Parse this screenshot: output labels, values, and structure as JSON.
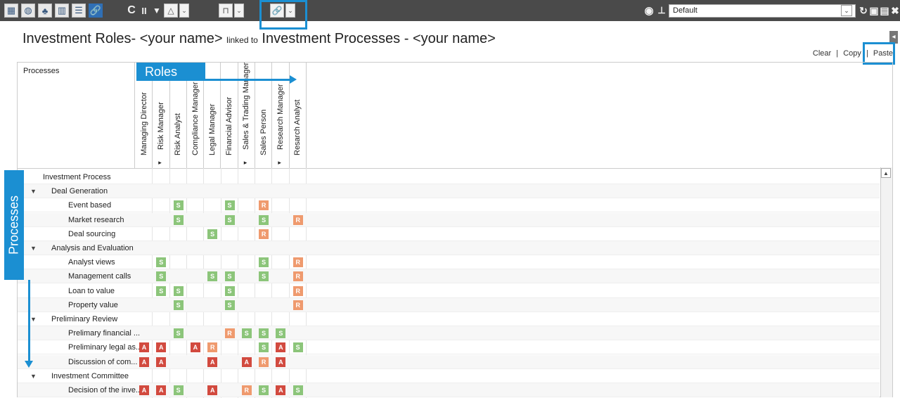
{
  "toolbar": {
    "left_icons": [
      {
        "name": "table-view-icon",
        "glyph": "▦"
      },
      {
        "name": "dashboard-icon",
        "glyph": "◍"
      },
      {
        "name": "hierarchy-icon",
        "glyph": "♣"
      },
      {
        "name": "bar-chart-icon",
        "glyph": "▥"
      },
      {
        "name": "list-icon",
        "glyph": "☰"
      },
      {
        "name": "link-icon",
        "glyph": "🔗"
      }
    ],
    "refresh_glyph": "C",
    "pause_glyph": "II",
    "filter_glyph": "▼",
    "triangle_glyph": "△",
    "bookmark_glyph": "⊓",
    "link_glyph": "🔗",
    "caret_glyph": "⌄",
    "camera_glyph": "◉",
    "pin_glyph": "⊥",
    "preset_value": "Default",
    "right_glyphs": [
      {
        "name": "refresh-icon",
        "glyph": "↻"
      },
      {
        "name": "save-as-icon",
        "glyph": "▣"
      },
      {
        "name": "save-icon",
        "glyph": "▤"
      },
      {
        "name": "close-icon",
        "glyph": "✖"
      }
    ]
  },
  "title": {
    "left": "Investment Roles- <your name>",
    "linked": "linked to",
    "right": "Investment Processes - <your name>"
  },
  "actions": {
    "clear": "Clear",
    "sep1": "|",
    "copy": "Copy",
    "sep2": "|",
    "paste": "Paste"
  },
  "grid": {
    "processes_header": "Processes",
    "roles": [
      {
        "label": "Managing Director",
        "arrow": false
      },
      {
        "label": "Risk Manager",
        "arrow": true
      },
      {
        "label": "Risk Analyst",
        "arrow": false
      },
      {
        "label": "Compliance Manager",
        "arrow": false
      },
      {
        "label": "Legal Manager",
        "arrow": false
      },
      {
        "label": "Financial Advisor",
        "arrow": false
      },
      {
        "label": "Sales & Trading Manager",
        "arrow": true
      },
      {
        "label": "Sales Person",
        "arrow": false
      },
      {
        "label": "Research Manager",
        "arrow": true
      },
      {
        "label": "Resarch Analyst",
        "arrow": false
      }
    ],
    "rows": [
      {
        "label": "Investment Process",
        "level": 0,
        "toggle": true,
        "cells": [
          "",
          "",
          "",
          "",
          "",
          "",
          "",
          "",
          "",
          ""
        ]
      },
      {
        "label": "Deal Generation",
        "level": 1,
        "toggle": true,
        "cells": [
          "",
          "",
          "",
          "",
          "",
          "",
          "",
          "",
          "",
          ""
        ]
      },
      {
        "label": "Event based",
        "level": 2,
        "toggle": false,
        "cells": [
          "",
          "",
          "S",
          "",
          "",
          "S",
          "",
          "R",
          "",
          ""
        ]
      },
      {
        "label": "Market research",
        "level": 2,
        "toggle": false,
        "cells": [
          "",
          "",
          "S",
          "",
          "",
          "S",
          "",
          "S",
          "",
          "R"
        ]
      },
      {
        "label": "Deal sourcing",
        "level": 2,
        "toggle": false,
        "cells": [
          "",
          "",
          "",
          "",
          "S",
          "",
          "",
          "R",
          "",
          ""
        ]
      },
      {
        "label": "Analysis and Evaluation",
        "level": 1,
        "toggle": true,
        "cells": [
          "",
          "",
          "",
          "",
          "",
          "",
          "",
          "",
          "",
          ""
        ]
      },
      {
        "label": "Analyst views",
        "level": 2,
        "toggle": false,
        "cells": [
          "",
          "S",
          "",
          "",
          "",
          "",
          "",
          "S",
          "",
          "R"
        ]
      },
      {
        "label": "Management calls",
        "level": 2,
        "toggle": false,
        "cells": [
          "",
          "S",
          "",
          "",
          "S",
          "S",
          "",
          "S",
          "",
          "R"
        ]
      },
      {
        "label": "Loan to value",
        "level": 2,
        "toggle": false,
        "cells": [
          "",
          "S",
          "S",
          "",
          "",
          "S",
          "",
          "",
          "",
          "R"
        ]
      },
      {
        "label": "Property value",
        "level": 2,
        "toggle": false,
        "cells": [
          "",
          "",
          "S",
          "",
          "",
          "S",
          "",
          "",
          "",
          "R"
        ]
      },
      {
        "label": "Preliminary Review",
        "level": 1,
        "toggle": true,
        "cells": [
          "",
          "",
          "",
          "",
          "",
          "",
          "",
          "",
          "",
          ""
        ]
      },
      {
        "label": "Prelimary financial ...",
        "level": 2,
        "toggle": false,
        "cells": [
          "",
          "",
          "S",
          "",
          "",
          "R",
          "S",
          "S",
          "S",
          ""
        ]
      },
      {
        "label": "Preliminary legal as...",
        "level": 2,
        "toggle": false,
        "cells": [
          "A",
          "A",
          "",
          "A",
          "R",
          "",
          "",
          "S",
          "A",
          "S"
        ]
      },
      {
        "label": "Discussion of com...",
        "level": 2,
        "toggle": false,
        "cells": [
          "A",
          "A",
          "",
          "",
          "A",
          "",
          "A",
          "R",
          "A",
          ""
        ]
      },
      {
        "label": "Investment Committee",
        "level": 1,
        "toggle": true,
        "cells": [
          "",
          "",
          "",
          "",
          "",
          "",
          "",
          "",
          "",
          ""
        ]
      },
      {
        "label": "Decision of the inve...",
        "level": 2,
        "toggle": false,
        "cells": [
          "A",
          "A",
          "S",
          "",
          "A",
          "",
          "R",
          "S",
          "A",
          "S"
        ]
      }
    ]
  },
  "callouts": {
    "roles": "Roles",
    "processes": "Processes"
  },
  "colors": {
    "S": "#8cc57a",
    "R": "#ef9a6e",
    "A": "#d24a3f",
    "accent": "#1b8fd2"
  }
}
